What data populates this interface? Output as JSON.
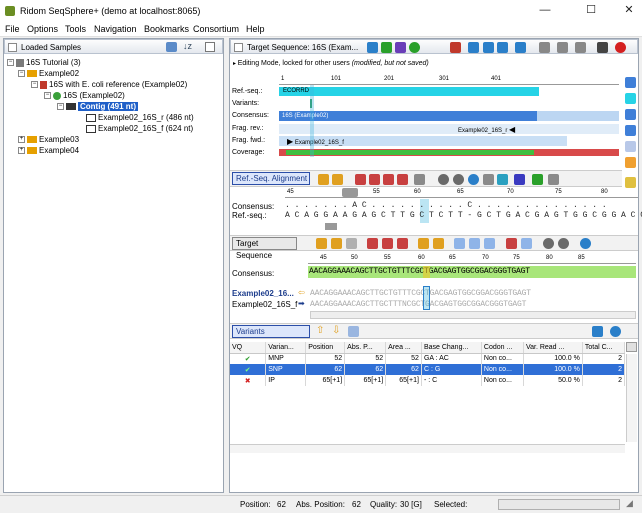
{
  "window": {
    "title": "Ridom SeqSphere+ (demo at localhost:8065)",
    "minimize": "—",
    "maximize": "☐",
    "close": "✕"
  },
  "menu": [
    "File",
    "Options",
    "Tools",
    "Navigation",
    "Bookmarks",
    "Consortium",
    "Help"
  ],
  "left": {
    "header": "Loaded Samples",
    "tree": [
      {
        "label": "16S Tutorial (3)",
        "expander": "−"
      },
      {
        "label": "Example02",
        "expander": "−"
      },
      {
        "label": "16S with E. coli reference (Example02)",
        "expander": "−"
      },
      {
        "label": "16S (Example02)",
        "expander": "−"
      },
      {
        "label": "Contig (491 nt)",
        "expander": "−"
      },
      {
        "label": "Example02_16S_r (486 nt)"
      },
      {
        "label": "Example02_16S_f (624 nt)"
      },
      {
        "label": "Example03",
        "expander": "+"
      },
      {
        "label": "Example04",
        "expander": "+"
      }
    ]
  },
  "right": {
    "header": "Target Sequence: 16S (Exam...",
    "editing_note_prefix": "Editing Mode, locked for other users",
    "editing_note_suffix": "(modified, but not saved)",
    "overview": {
      "ruler": [
        "1",
        "101",
        "201",
        "301",
        "401"
      ],
      "rows": [
        "Ref.-seq.:",
        "Variants:",
        "Consensus:",
        "Frag. rev.:",
        "Frag. fwd.:",
        "Coverage:"
      ],
      "ref_bar": "ECORRD",
      "consensus_bar": "16S (Example02)",
      "frag_rev": "Example02_16S_r",
      "frag_fwd": "Example02_16S_f"
    },
    "ref_alignment": {
      "tab": "Ref.-Seq. Alignment",
      "ruler": [
        "45",
        "50",
        "55",
        "60",
        "65",
        "70",
        "75",
        "80"
      ],
      "consensus_label": "Consensus:",
      "refseq_label": "Ref.-seq.:",
      "consensus_seq": ". . . . . . . A C . . . . . . . . . . C . . . . . . . . . . . . . .",
      "ref_seq": "A C A G G A A G A G C T T G C T C T T - G C T G A C G A G T G G C G G A C G"
    },
    "target_sequence": {
      "tab": "Target Sequence",
      "ruler": [
        "45",
        "50",
        "55",
        "60",
        "65",
        "70",
        "75",
        "80",
        "85"
      ],
      "consensus_label": "Consensus:",
      "consensus_seq": "AACAGGAAACAGCTTGCTGTTTCGCTGACGAGTGGCGGACGGGTGAGT",
      "read1_label": "Example02_16...",
      "read1_seq": "AACAGGAAACAGCTTGCTGTTTCGCTGACGAGTGGCGGACGGGTGAGT",
      "read2_label": "Example02_16S_f",
      "read2_seq": "AACAGGAAACAGCTTGCTTTNCGCTGACGAGTGGCGGACGGGTGAGT"
    },
    "variants": {
      "tab": "Variants",
      "columns": [
        "VQ",
        "Varian...",
        "Position",
        "Abs. P...",
        "Area ...",
        "Base Chang...",
        "Codon ...",
        "Var. Read ...",
        "Total C..."
      ],
      "rows": [
        {
          "vq": "✔",
          "vq_color": "#2a9d2a",
          "type": "MNP",
          "pos": "52",
          "abs": "52",
          "area": "52",
          "change": "GA : AC",
          "codon": "Non co...",
          "read": "100.0 %",
          "total": "2"
        },
        {
          "vq": "✔",
          "vq_color": "#2a9d2a",
          "type": "SNP",
          "pos": "62",
          "abs": "62",
          "area": "62",
          "change": "C : G",
          "codon": "Non co...",
          "read": "100.0 %",
          "total": "2"
        },
        {
          "vq": "✖",
          "vq_color": "#d42020",
          "type": "IP",
          "pos": "65[+1]",
          "abs": "65[+1]",
          "area": "65[+1]",
          "change": "- : C",
          "codon": "Non co...",
          "read": "50.0 %",
          "total": "2"
        }
      ]
    }
  },
  "status": {
    "position_label": "Position:",
    "position": "62",
    "abs_label": "Abs. Position:",
    "abs": "62",
    "quality_label": "Quality:",
    "quality": "30 [G]",
    "selected_label": "Selected:"
  }
}
